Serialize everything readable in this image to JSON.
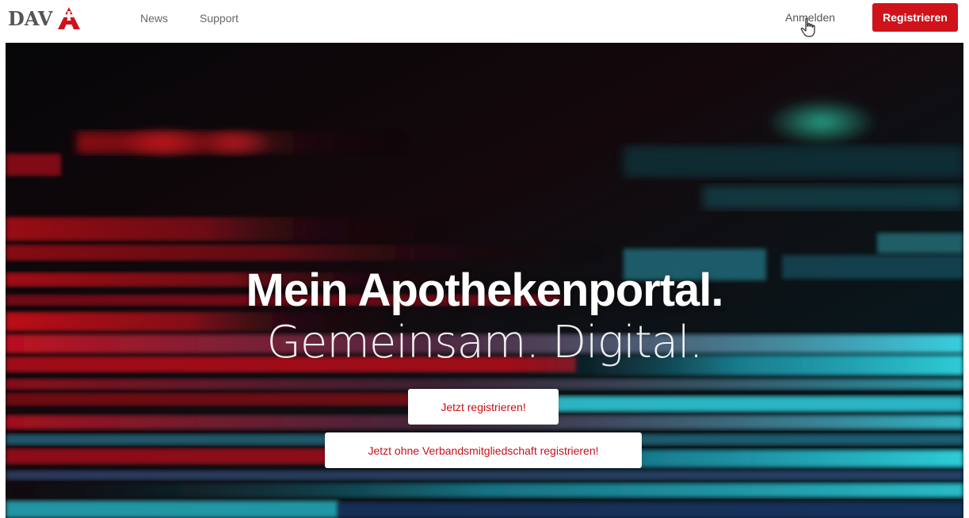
{
  "header": {
    "logo_text": "DAV",
    "logo_icon": "apotheke-a-icon",
    "nav": [
      {
        "label": "News"
      },
      {
        "label": "Support"
      }
    ],
    "login_label": "Anmelden",
    "register_label": "Registrieren"
  },
  "hero": {
    "title": "Mein Apothekenportal.",
    "subtitle": "Gemeinsam. Digital.",
    "primary_cta": "Jetzt registrieren!",
    "secondary_cta": "Jetzt ohne Verbandsmitgliedschaft registrieren!"
  },
  "colors": {
    "brand_red": "#d0121b",
    "accent_cyan": "#2fd6e0",
    "nav_text": "#666666"
  }
}
